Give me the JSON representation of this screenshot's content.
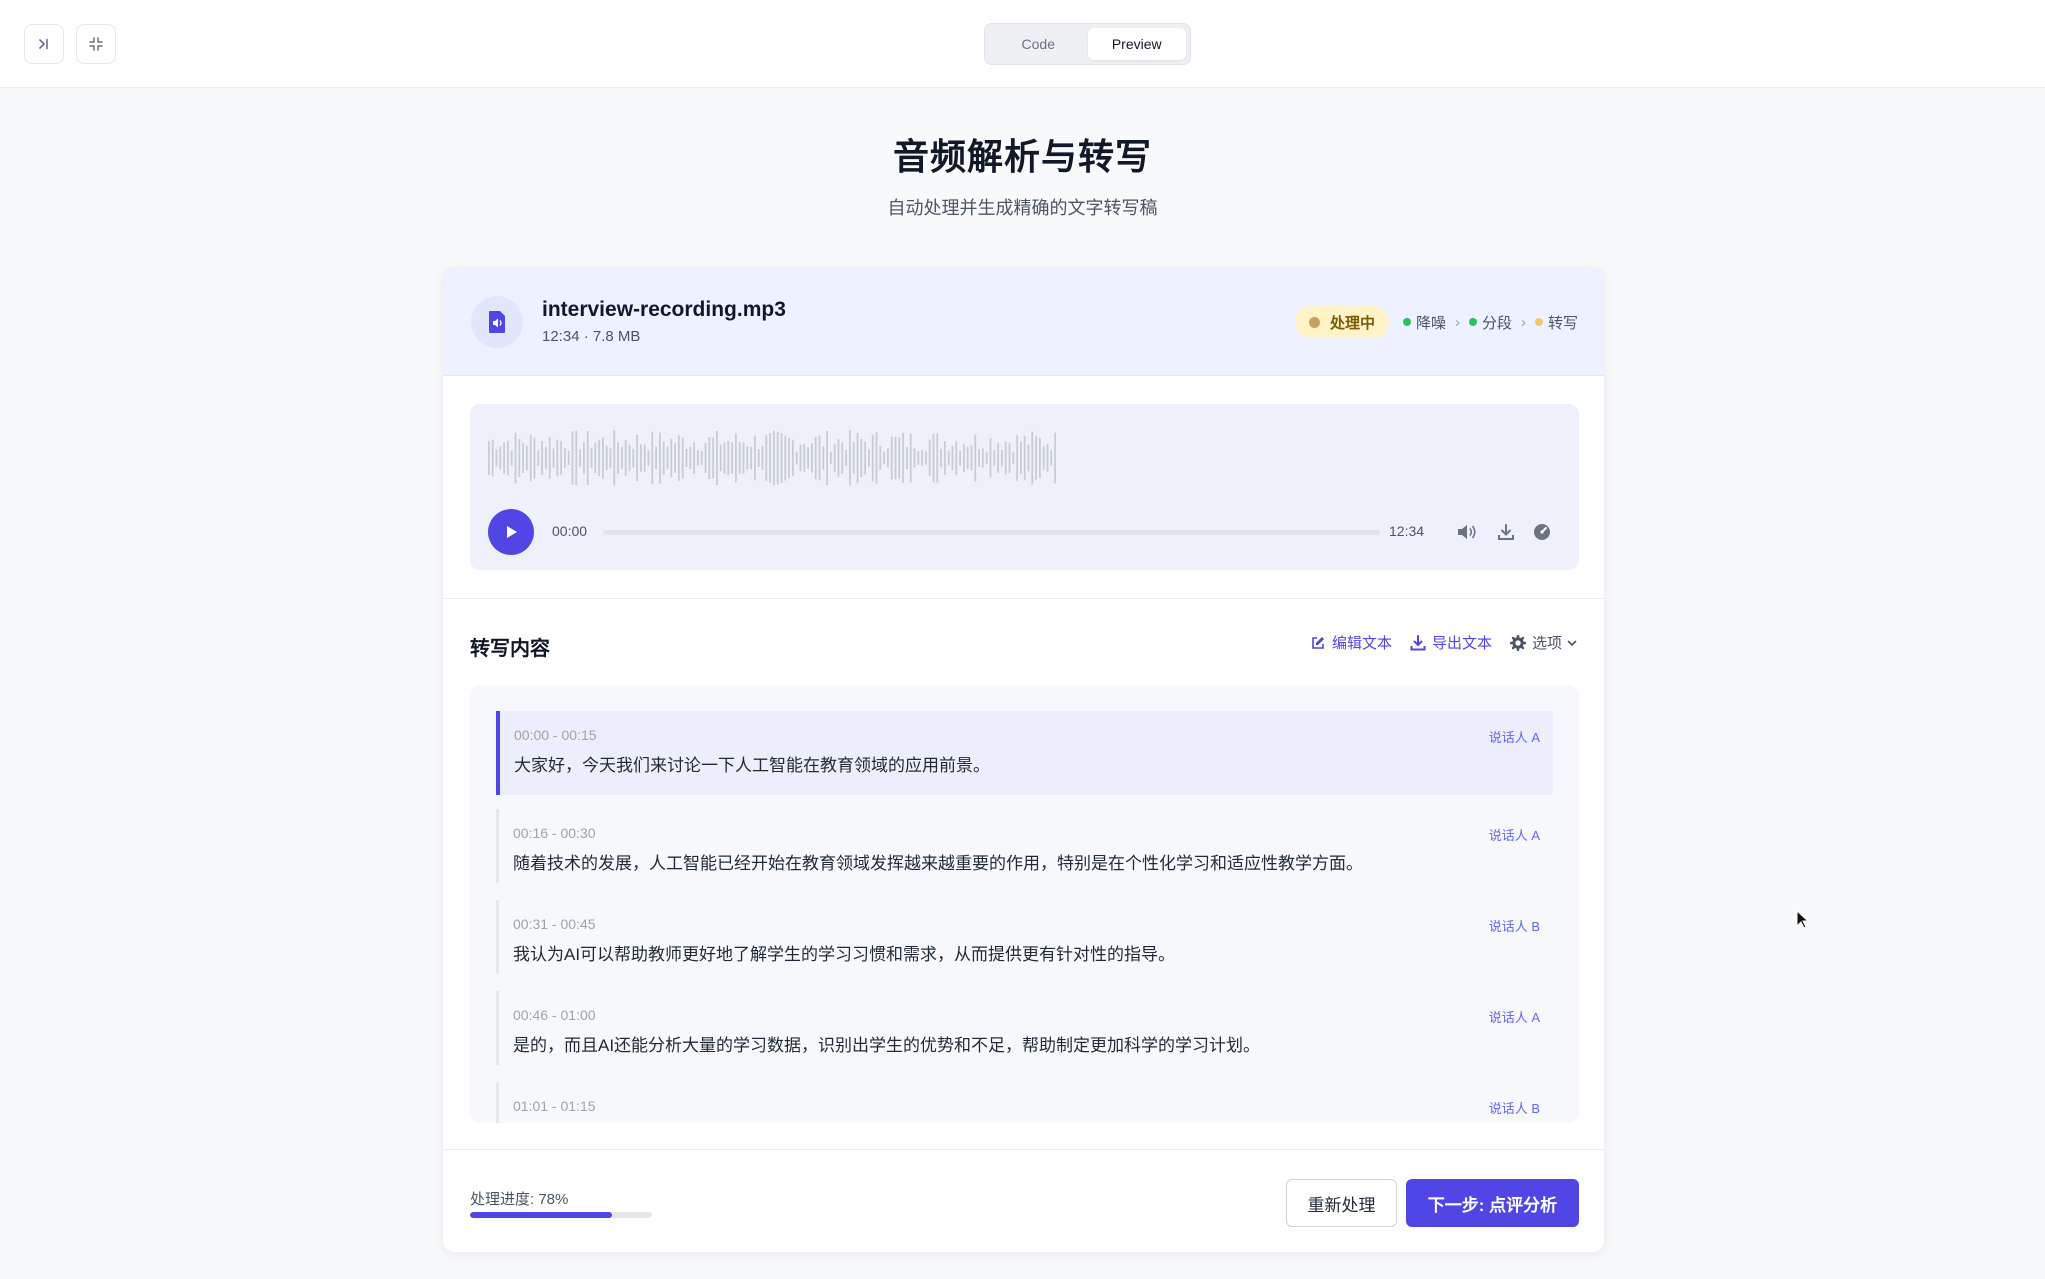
{
  "topbar": {
    "code_label": "Code",
    "preview_label": "Preview"
  },
  "heading": {
    "title": "音频解析与转写",
    "subtitle": "自动处理并生成精确的文字转写稿"
  },
  "file": {
    "name": "interview-recording.mp3",
    "meta": "12:34 · 7.8 MB",
    "status": "处理中",
    "steps": [
      {
        "label": "降噪",
        "color": "#22c55e"
      },
      {
        "label": "分段",
        "color": "#22c55e"
      },
      {
        "label": "转写",
        "color": "#f5c96a"
      }
    ]
  },
  "player": {
    "current_time": "00:00",
    "duration": "12:34",
    "progress": 0
  },
  "transcript": {
    "title": "转写内容",
    "edit_label": "编辑文本",
    "export_label": "导出文本",
    "options_label": "选项",
    "segments": [
      {
        "time": "00:00 - 00:15",
        "speaker": "说话人 A",
        "text": "大家好，今天我们来讨论一下人工智能在教育领域的应用前景。"
      },
      {
        "time": "00:16 - 00:30",
        "speaker": "说话人 A",
        "text": "随着技术的发展，人工智能已经开始在教育领域发挥越来越重要的作用，特别是在个性化学习和适应性教学方面。"
      },
      {
        "time": "00:31 - 00:45",
        "speaker": "说话人 B",
        "text": "我认为AI可以帮助教师更好地了解学生的学习习惯和需求，从而提供更有针对性的指导。"
      },
      {
        "time": "00:46 - 01:00",
        "speaker": "说话人 A",
        "text": "是的，而且AI还能分析大量的学习数据，识别出学生的优势和不足，帮助制定更加科学的学习计划。"
      },
      {
        "time": "01:01 - 01:15",
        "speaker": "说话人 B",
        "text": ""
      }
    ]
  },
  "footer": {
    "progress_label": "处理进度: 78%",
    "progress_value": 78,
    "reprocess_label": "重新处理",
    "next_label": "下一步: 点评分析"
  },
  "colors": {
    "accent": "#4f46e5",
    "status_bg": "#fdf3c7"
  }
}
